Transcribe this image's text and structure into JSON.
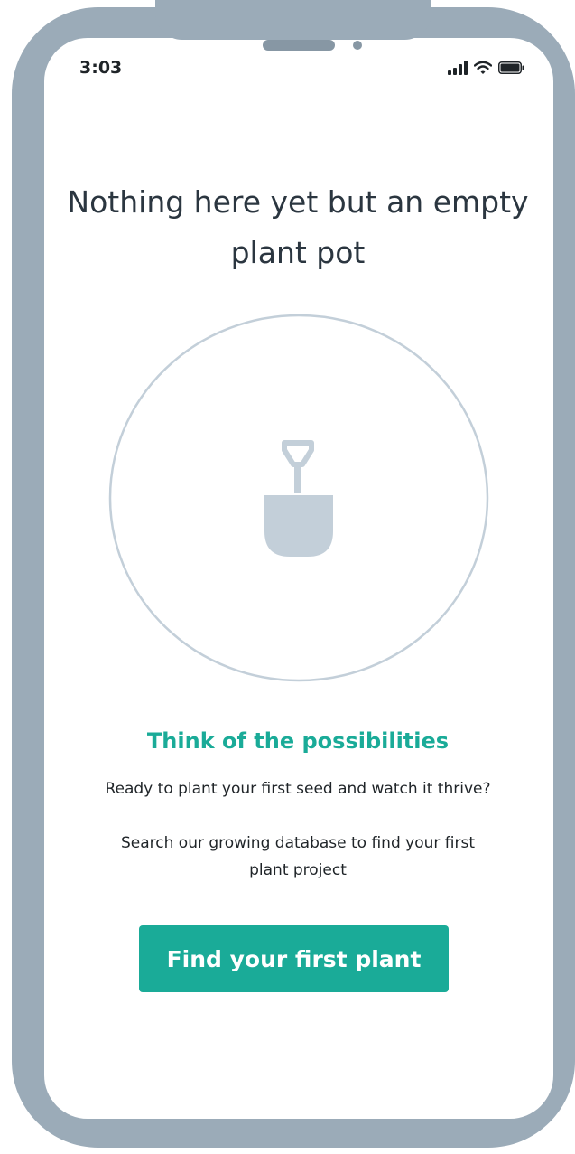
{
  "status_bar": {
    "time": "3:03",
    "icons": [
      "cellular-signal-icon",
      "wifi-icon",
      "battery-icon"
    ]
  },
  "empty_state": {
    "headline": "Nothing here yet but an empty plant pot",
    "illustration_icon": "shovel-icon",
    "subheading": "Think of the possibilities",
    "body_line": "Ready to plant your first seed and watch it thrive?",
    "body_paragraph": "Search our growing database to find your first plant project"
  },
  "cta": {
    "label": "Find your first plant"
  },
  "colors": {
    "accent": "#1aab98",
    "frame": "#9babb8",
    "illustration": "#c3cfd9",
    "text_dark": "#2b3640"
  }
}
